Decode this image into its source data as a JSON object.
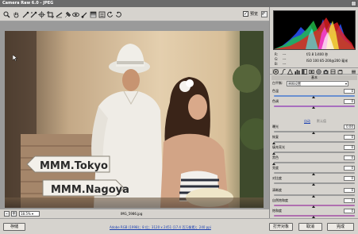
{
  "window": {
    "title": "Camera Raw 6.0 -  JPEG"
  },
  "toolbar": {
    "tools": [
      "zoom-icon",
      "hand-icon",
      "white-balance-icon",
      "color-sampler-icon",
      "targeted-adjust-icon",
      "crop-icon",
      "straighten-icon",
      "spot-removal-icon",
      "red-eye-icon",
      "adjustment-brush-icon",
      "graduated-filter-icon",
      "preferences-icon",
      "rotate-ccw-icon",
      "rotate-cw-icon"
    ],
    "preview_label": "预览",
    "preview_checked": "✓"
  },
  "photo": {
    "sign1": "MMM.Tokyo",
    "sign2": "MMM.Nagoya"
  },
  "statusbar": {
    "zoom_value": "18.5%",
    "filename": "IMG_5986.jpg",
    "zoom_minus": "-",
    "zoom_plus": "+"
  },
  "bottom": {
    "save_label": "存储",
    "info_link": "Adobe RGB (1998)；8 位；3120 x 2451 (17.4 百万像素)；240 ppi",
    "open_label": "打开对象",
    "cancel_label": "取消",
    "done_label": "完成"
  },
  "readout": {
    "r_label": "R:",
    "g_label": "G:",
    "b_label": "B:",
    "r_value": "---",
    "g_value": "---",
    "b_value": "---",
    "exif1": "f/2.8  1/400 秒",
    "exif2": "ISO 100   85-200@200 毫米"
  },
  "panel": {
    "section_title": "基本",
    "wb_label": "白平衡:",
    "wb_value": "原照设置",
    "auto_link": "自动",
    "default_link": "默认值",
    "sliders_top": [
      {
        "label": "色温",
        "value": "0",
        "track_color": "#6a8fd0",
        "position": 0.5
      },
      {
        "label": "色调",
        "value": "0",
        "track_color": "#a86fbf",
        "position": 0.5
      }
    ],
    "sliders_mid": [
      {
        "label": "曝光",
        "value": "0.00",
        "track_color": "#9a9a9a",
        "position": 0.5
      },
      {
        "label": "恢复",
        "value": "0",
        "track_color": "#9a9a9a",
        "position": 0.0
      },
      {
        "label": "填充亮光",
        "value": "0",
        "track_color": "#9a9a9a",
        "position": 0.0
      },
      {
        "label": "黑色",
        "value": "0",
        "track_color": "#9a9a9a",
        "position": 0.0
      }
    ],
    "sliders_tone": [
      {
        "label": "亮度",
        "value": "0",
        "track_color": "#9a9a9a",
        "position": 0.5
      },
      {
        "label": "对比度",
        "value": "0",
        "track_color": "#9a9a9a",
        "position": 0.5
      }
    ],
    "sliders_pres": [
      {
        "label": "清晰度",
        "value": "0",
        "track_color": "#9a9a9a",
        "position": 0.5
      },
      {
        "label": "自然饱和度",
        "value": "0",
        "track_color": "#b06fb0",
        "position": 0.5
      },
      {
        "label": "饱和度",
        "value": "0",
        "track_color": "#b06fb0",
        "position": 0.5
      }
    ]
  }
}
